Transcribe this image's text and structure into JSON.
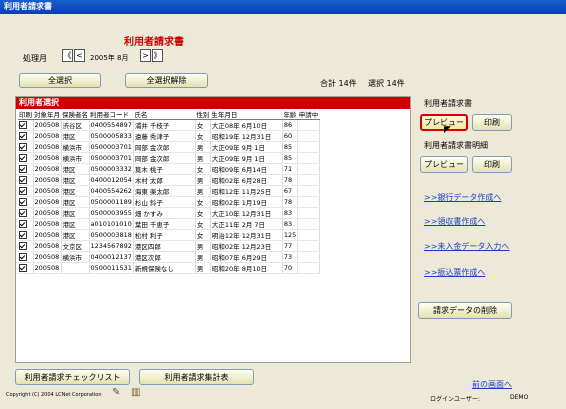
{
  "window": {
    "title": "利用者請求書"
  },
  "header": {
    "title": "利用者請求書"
  },
  "period": {
    "label": "処理月",
    "value": "2005年 8月",
    "prev_year": "《",
    "prev_month": "<",
    "next_month": ">",
    "next_year": "》"
  },
  "selection": {
    "select_all": "全選択",
    "deselect_all": "全選択解除",
    "total": "合計 14件",
    "selected": "選択 14件"
  },
  "list": {
    "title": "利用者選択",
    "columns": [
      "印刷",
      "対象年月",
      "保険者名",
      "利用者コード",
      "氏名",
      "性別",
      "生年月日",
      "年齢",
      "申請中"
    ],
    "rows": [
      {
        "checked": true,
        "month": "200508",
        "insurer": "渋谷区",
        "code": "0400554897",
        "name": "浦井 千枝子",
        "sex": "女",
        "dob": "大正08年 6月10日",
        "age": "86",
        "pending": ""
      },
      {
        "checked": true,
        "month": "200508",
        "insurer": "港区",
        "code": "0500005833",
        "name": "遠藤 秀津子",
        "sex": "女",
        "dob": "昭和19年 12月31日",
        "age": "60",
        "pending": ""
      },
      {
        "checked": true,
        "month": "200508",
        "insurer": "横浜市",
        "code": "0500003701",
        "name": "岡部 金次郎",
        "sex": "男",
        "dob": "大正09年 9月 1日",
        "age": "85",
        "pending": ""
      },
      {
        "checked": true,
        "month": "200508",
        "insurer": "横浜市",
        "code": "0500003701",
        "name": "岡部 金次郎",
        "sex": "男",
        "dob": "大正09年 9月 1日",
        "age": "85",
        "pending": ""
      },
      {
        "checked": true,
        "month": "200508",
        "insurer": "港区",
        "code": "0500003332",
        "name": "筧木 桃子",
        "sex": "女",
        "dob": "昭和09年 6月14日",
        "age": "71",
        "pending": ""
      },
      {
        "checked": true,
        "month": "200508",
        "insurer": "港区",
        "code": "0400012054",
        "name": "木村 太郎",
        "sex": "男",
        "dob": "昭和02年 6月28日",
        "age": "78",
        "pending": ""
      },
      {
        "checked": true,
        "month": "200508",
        "insurer": "港区",
        "code": "0400554262",
        "name": "海東 楽太郎",
        "sex": "男",
        "dob": "昭和12年 11月25日",
        "age": "67",
        "pending": ""
      },
      {
        "checked": true,
        "month": "200508",
        "insurer": "港区",
        "code": "0500001189",
        "name": "杉山 鈴子",
        "sex": "女",
        "dob": "昭和02年 1月19日",
        "age": "78",
        "pending": ""
      },
      {
        "checked": true,
        "month": "200508",
        "insurer": "港区",
        "code": "0500003955",
        "name": "畑 かすみ",
        "sex": "女",
        "dob": "大正10年 12月31日",
        "age": "83",
        "pending": ""
      },
      {
        "checked": true,
        "month": "200508",
        "insurer": "港区",
        "code": "a010101010",
        "name": "葉田 千恵子",
        "sex": "女",
        "dob": "大正11年 2月 7日",
        "age": "83",
        "pending": ""
      },
      {
        "checked": true,
        "month": "200508",
        "insurer": "港区",
        "code": "0500003818",
        "name": "松村 利子",
        "sex": "女",
        "dob": "明治12年 12月31日",
        "age": "125",
        "pending": ""
      },
      {
        "checked": true,
        "month": "200508",
        "insurer": "文京区",
        "code": "1234567892",
        "name": "港区四郎",
        "sex": "男",
        "dob": "昭和02年 12月23日",
        "age": "77",
        "pending": ""
      },
      {
        "checked": true,
        "month": "200508",
        "insurer": "横浜市",
        "code": "0400012137",
        "name": "港区次郎",
        "sex": "男",
        "dob": "昭和07年 6月29日",
        "age": "73",
        "pending": ""
      },
      {
        "checked": true,
        "month": "200508",
        "insurer": "",
        "code": "0500011531",
        "name": "新規保険なし",
        "sex": "男",
        "dob": "昭和20年 8月10日",
        "age": "70",
        "pending": ""
      }
    ]
  },
  "invoice": {
    "title": "利用者請求書",
    "preview": "プレビュー",
    "print": "印刷"
  },
  "detail": {
    "title": "利用者請求書明細",
    "preview": "プレビュー",
    "print": "印刷"
  },
  "links": {
    "bank": ">>銀行データ作成へ",
    "receipt": ">>領収書作成へ",
    "unpaid": ">>未入金データ入力へ",
    "transfer": ">>振込票作成へ",
    "back": "前の画面へ"
  },
  "actions": {
    "delete_billing": "請求データの削除",
    "checklist": "利用者請求チェックリスト",
    "summary": "利用者請求集計表"
  },
  "footer": {
    "copyright": "Copyright (C) 2004 LCNet Corporation",
    "login_label": "ログインユーザー:",
    "login_user": "DEMO"
  }
}
